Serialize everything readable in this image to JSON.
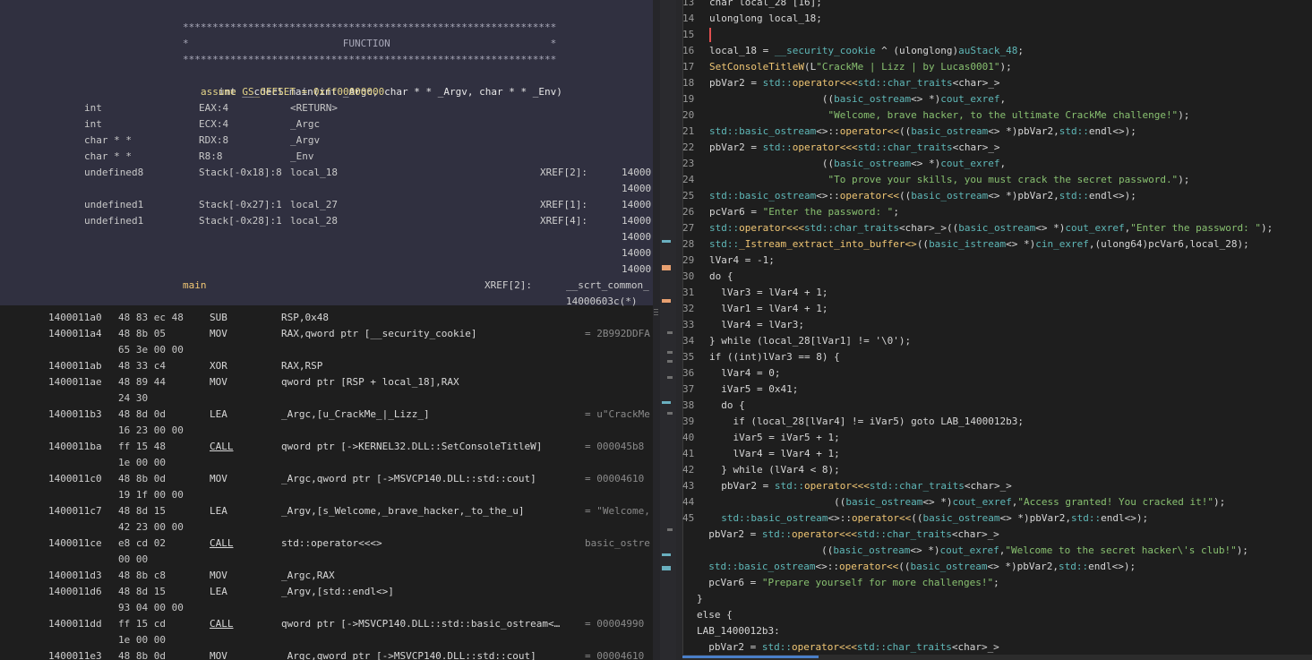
{
  "listing": {
    "header": {
      "stars_top": "***************************************************************",
      "function_line": "*                          FUNCTION                           *",
      "stars_bottom": "***************************************************************",
      "signature": "int __cdecl main(int _Argc, char * * _Argv, char * * _Env)",
      "assume": "assume GS_OFFSET = 0xff00000000",
      "params": [
        {
          "type": "int",
          "storage": "EAX:4",
          "name": "<RETURN>",
          "xref": ""
        },
        {
          "type": "int",
          "storage": "ECX:4",
          "name": "_Argc",
          "xref": ""
        },
        {
          "type": "char * *",
          "storage": "RDX:8",
          "name": "_Argv",
          "xref": ""
        },
        {
          "type": "char * *",
          "storage": "R8:8",
          "name": "_Env",
          "xref": ""
        },
        {
          "type": "undefined8",
          "storage": "Stack[-0x18]:8",
          "name": "local_18",
          "xref": "XREF[2]:"
        },
        {
          "type": "undefined1",
          "storage": "Stack[-0x27]:1",
          "name": "local_27",
          "xref": "XREF[1]:"
        },
        {
          "type": "undefined1",
          "storage": "Stack[-0x28]:1",
          "name": "local_28",
          "xref": "XREF[4]:"
        }
      ],
      "xref_addrs": [
        "14000",
        "14000",
        "14000",
        "14000",
        "14000",
        "14000",
        "14000",
        "14000"
      ],
      "label": "main",
      "label_xref": "XREF[2]:",
      "label_xref_name": "__scrt_common_",
      "label_xref_addr": "14000603c(*)"
    },
    "rows": [
      {
        "addr": "1400011a0",
        "bytes": "48 83 ec 48",
        "mn": "SUB",
        "ops": "RSP,0x48",
        "cmt": ""
      },
      {
        "addr": "1400011a4",
        "bytes": "48 8b 05",
        "mn": "MOV",
        "ops": "RAX,qword ptr [__security_cookie]",
        "cmt": "= 2B992DDFA"
      },
      {
        "addr": "",
        "bytes": "65 3e 00 00",
        "mn": "",
        "ops": "",
        "cmt": ""
      },
      {
        "addr": "1400011ab",
        "bytes": "48 33 c4",
        "mn": "XOR",
        "ops": "RAX,RSP",
        "cmt": ""
      },
      {
        "addr": "1400011ae",
        "bytes": "48 89 44",
        "mn": "MOV",
        "ops": "qword ptr [RSP + local_18],RAX",
        "cmt": ""
      },
      {
        "addr": "",
        "bytes": "24 30",
        "mn": "",
        "ops": "",
        "cmt": ""
      },
      {
        "addr": "1400011b3",
        "bytes": "48 8d 0d",
        "mn": "LEA",
        "ops": "_Argc,[u_CrackMe_|_Lizz_]",
        "cmt": "= u\"CrackMe"
      },
      {
        "addr": "",
        "bytes": "16 23 00 00",
        "mn": "",
        "ops": "",
        "cmt": ""
      },
      {
        "addr": "1400011ba",
        "bytes": "ff 15 48",
        "mn": "CALL",
        "ops": "qword ptr [->KERNEL32.DLL::SetConsoleTitleW]",
        "cmt": "= 000045b8"
      },
      {
        "addr": "",
        "bytes": "1e 00 00",
        "mn": "",
        "ops": "",
        "cmt": ""
      },
      {
        "addr": "1400011c0",
        "bytes": "48 8b 0d",
        "mn": "MOV",
        "ops": "_Argc,qword ptr [->MSVCP140.DLL::std::cout]",
        "cmt": "= 00004610"
      },
      {
        "addr": "",
        "bytes": "19 1f 00 00",
        "mn": "",
        "ops": "",
        "cmt": ""
      },
      {
        "addr": "1400011c7",
        "bytes": "48 8d 15",
        "mn": "LEA",
        "ops": "_Argv,[s_Welcome,_brave_hacker,_to_the_u]",
        "cmt": "= \"Welcome,"
      },
      {
        "addr": "",
        "bytes": "42 23 00 00",
        "mn": "",
        "ops": "",
        "cmt": ""
      },
      {
        "addr": "1400011ce",
        "bytes": "e8 cd 02",
        "mn": "CALL",
        "ops": "std::operator<<<>",
        "cmt": "basic_ostre"
      },
      {
        "addr": "",
        "bytes": "00 00",
        "mn": "",
        "ops": "",
        "cmt": ""
      },
      {
        "addr": "1400011d3",
        "bytes": "48 8b c8",
        "mn": "MOV",
        "ops": "_Argc,RAX",
        "cmt": ""
      },
      {
        "addr": "1400011d6",
        "bytes": "48 8d 15",
        "mn": "LEA",
        "ops": "_Argv,[std::endl<>]",
        "cmt": ""
      },
      {
        "addr": "",
        "bytes": "93 04 00 00",
        "mn": "",
        "ops": "",
        "cmt": ""
      },
      {
        "addr": "1400011dd",
        "bytes": "ff 15 cd",
        "mn": "CALL",
        "ops": "qword ptr [->MSVCP140.DLL::std::basic_ostream<…",
        "cmt": "= 00004990"
      },
      {
        "addr": "",
        "bytes": "1e 00 00",
        "mn": "",
        "ops": "",
        "cmt": ""
      },
      {
        "addr": "1400011e3",
        "bytes": "48 8b 0d",
        "mn": "MOV",
        "ops": "_Argc,qword ptr [->MSVCP140.DLL::std::cout]",
        "cmt": "= 00004610"
      }
    ]
  },
  "decompiler": {
    "lines": [
      {
        "n": "13",
        "t": "char local_28 [16];"
      },
      {
        "n": "14",
        "t": "ulonglong local_18;"
      },
      {
        "n": "15",
        "t": ""
      },
      {
        "n": "16",
        "t": "local_18 = __security_cookie ^ (ulonglong)auStack_48;"
      },
      {
        "n": "17",
        "t": "SetConsoleTitleW(L\"CrackMe | Lizz | by Lucas0001\");"
      },
      {
        "n": "18",
        "t": "pbVar2 = std::operator<<<std::char_traits<char>_>"
      },
      {
        "n": "19",
        "t": "                   ((basic_ostream<> *)cout_exref,"
      },
      {
        "n": "20",
        "t": "                    \"Welcome, brave hacker, to the ultimate CrackMe challenge!\");"
      },
      {
        "n": "21",
        "t": "std::basic_ostream<>::operator<<((basic_ostream<> *)pbVar2,std::endl<>);"
      },
      {
        "n": "22",
        "t": "pbVar2 = std::operator<<<std::char_traits<char>_>"
      },
      {
        "n": "23",
        "t": "                   ((basic_ostream<> *)cout_exref,"
      },
      {
        "n": "24",
        "t": "                    \"To prove your skills, you must crack the secret password.\");"
      },
      {
        "n": "25",
        "t": "std::basic_ostream<>::operator<<((basic_ostream<> *)pbVar2,std::endl<>);"
      },
      {
        "n": "26",
        "t": "pcVar6 = \"Enter the password: \";"
      },
      {
        "n": "27",
        "t": "std::operator<<<std::char_traits<char>_>((basic_ostream<> *)cout_exref,\"Enter the password: \");"
      },
      {
        "n": "28",
        "t": "std::_Istream_extract_into_buffer<>((basic_istream<> *)cin_exref,(ulong64)pcVar6,local_28);"
      },
      {
        "n": "29",
        "t": "lVar4 = -1;"
      },
      {
        "n": "30",
        "t": "do {"
      },
      {
        "n": "31",
        "t": "  lVar3 = lVar4 + 1;"
      },
      {
        "n": "32",
        "t": "  lVar1 = lVar4 + 1;"
      },
      {
        "n": "33",
        "t": "  lVar4 = lVar3;"
      },
      {
        "n": "34",
        "t": "} while (local_28[lVar1] != '\\0');"
      },
      {
        "n": "35",
        "t": "if ((int)lVar3 == 8) {"
      },
      {
        "n": "36",
        "t": "  lVar4 = 0;"
      },
      {
        "n": "37",
        "t": "  iVar5 = 0x41;"
      },
      {
        "n": "38",
        "t": "  do {"
      },
      {
        "n": "39",
        "t": "    if (local_28[lVar4] != iVar5) goto LAB_1400012b3;"
      },
      {
        "n": "40",
        "t": "    iVar5 = iVar5 + 1;"
      },
      {
        "n": "41",
        "t": "    lVar4 = lVar4 + 1;"
      },
      {
        "n": "42",
        "t": "  } while (lVar4 < 8);"
      },
      {
        "n": "43",
        "t": "  pbVar2 = std::operator<<<std::char_traits<char>_>"
      },
      {
        "n": "44",
        "t": "                     ((basic_ostream<> *)cout_exref,\"Access granted! You cracked it!\");"
      },
      {
        "n": "45",
        "t": "  std::basic_ostream<>::operator<<((basic_ostream<> *)pbVar2,std::endl<>);"
      },
      {
        "n": "",
        "t": "  pbVar2 = std::operator<<<std::char_traits<char>_>"
      },
      {
        "n": "",
        "t": "                     ((basic_ostream<> *)cout_exref,\"Welcome to the secret hacker\\'s club!\");"
      },
      {
        "n": "",
        "t": "  std::basic_ostream<>::operator<<((basic_ostream<> *)pbVar2,std::endl<>);"
      },
      {
        "n": "",
        "t": "  pcVar6 = \"Prepare yourself for more challenges!\";"
      },
      {
        "n": "",
        "t": "}"
      },
      {
        "n": "",
        "t": "else {"
      },
      {
        "n": "",
        "t": "LAB_1400012b3:"
      },
      {
        "n": "",
        "t": "  pbVar2 = std::operator<<<std::char_traits<char>_>"
      }
    ]
  },
  "colors": {
    "header_bg": "#303040",
    "string": "#88c070",
    "function": "#f0c674",
    "type_ref": "#5fb8b8",
    "scroll_thumb": "#4a7fc8"
  }
}
